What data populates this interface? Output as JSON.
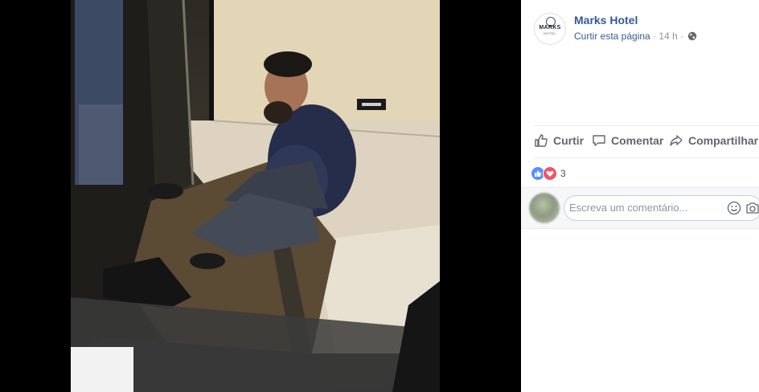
{
  "post": {
    "page_name": "Marks Hotel",
    "like_page": "Curtir esta página",
    "separator": "·",
    "time": "14 h",
    "logo": {
      "word": "MARKS",
      "sub": "HOTEL"
    }
  },
  "actions": {
    "like": "Curtir",
    "comment": "Comentar",
    "share": "Compartilhar"
  },
  "reactions": {
    "count": "3",
    "types": [
      "like-icon",
      "love-icon"
    ]
  },
  "comment_box": {
    "placeholder": "Escreva um comentário..."
  },
  "colors": {
    "link": "#365899",
    "meta": "#90949c",
    "action": "#606770",
    "like": "#5890ff",
    "love": "#f25268",
    "viewer_bg": "#000000"
  }
}
